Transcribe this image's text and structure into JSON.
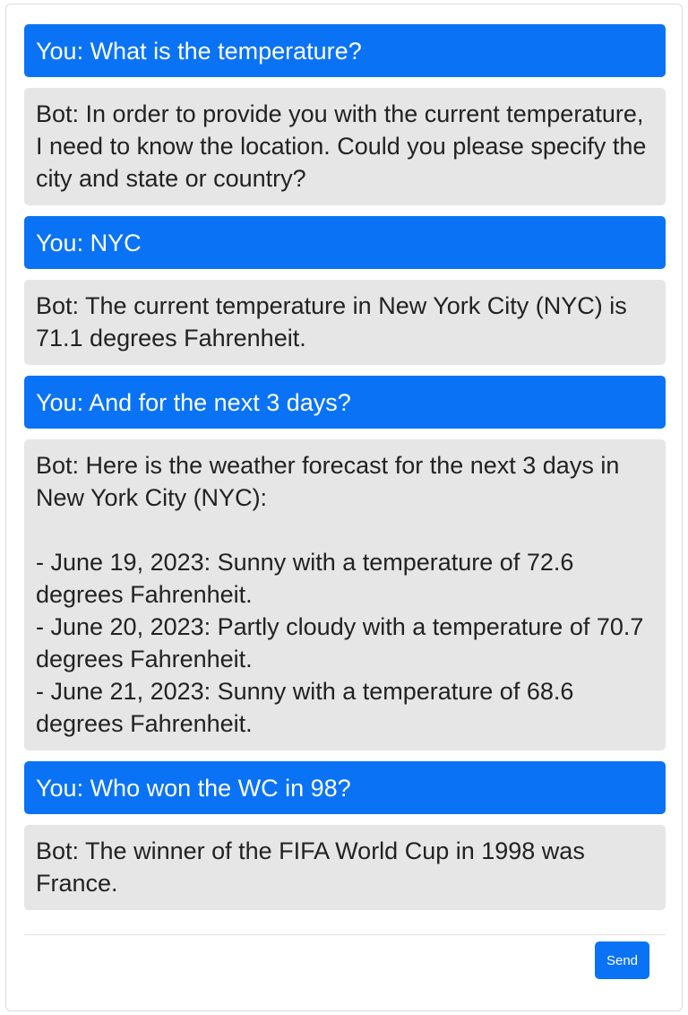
{
  "chat": {
    "messages": [
      {
        "role": "user",
        "text": "You: What is the temperature?"
      },
      {
        "role": "bot",
        "text": "Bot: In order to provide you with the current temperature, I need to know the location. Could you please specify the city and state or country?"
      },
      {
        "role": "user",
        "text": "You: NYC"
      },
      {
        "role": "bot",
        "text": "Bot: The current temperature in New York City (NYC) is 71.1 degrees Fahrenheit."
      },
      {
        "role": "user",
        "text": "You: And for the next 3 days?"
      },
      {
        "role": "bot",
        "text": "Bot: Here is the weather forecast for the next 3 days in New York City (NYC):\n\n- June 19, 2023: Sunny with a temperature of 72.6 degrees Fahrenheit.\n- June 20, 2023: Partly cloudy with a temperature of 70.7 degrees Fahrenheit.\n- June 21, 2023: Sunny with a temperature of 68.6 degrees Fahrenheit."
      },
      {
        "role": "user",
        "text": "You: Who won the WC in 98?"
      },
      {
        "role": "bot",
        "text": "Bot: The winner of the FIFA World Cup in 1998 was France."
      }
    ]
  },
  "composer": {
    "send_label": "Send"
  },
  "colors": {
    "user_bubble": "#0a73f5",
    "bot_bubble": "#e6e6e6",
    "send_button": "#0a73f5"
  }
}
